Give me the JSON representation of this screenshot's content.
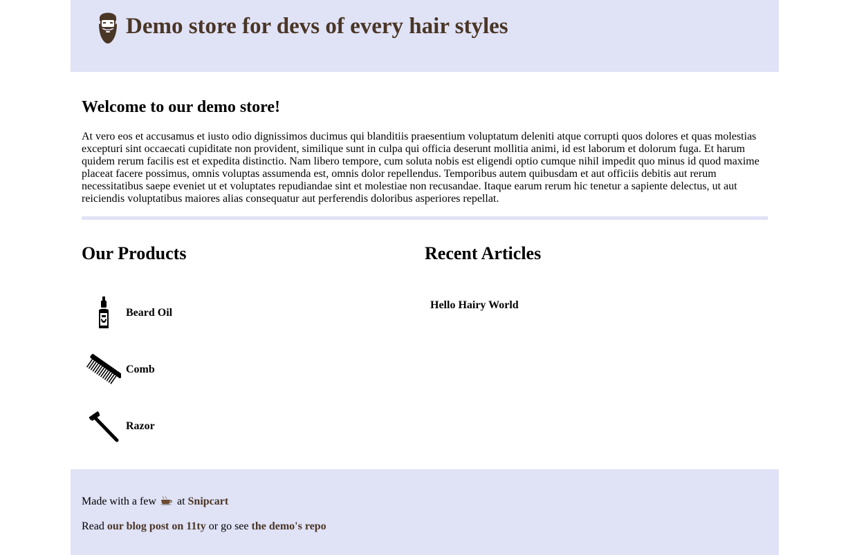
{
  "header": {
    "logo_icon": "bearded-man-icon",
    "title": "Demo store for devs of every hair styles",
    "brand_color": "#4a3626",
    "background": "#e0e2f6"
  },
  "main": {
    "welcome_title": "Welcome to our demo store!",
    "intro_text": "At vero eos et accusamus et iusto odio dignissimos ducimus qui blanditiis praesentium voluptatum deleniti atque corrupti quos dolores et quas molestias excepturi sint occaecati cupiditate non provident, similique sunt in culpa qui officia deserunt mollitia animi, id est laborum et dolorum fuga. Et harum quidem rerum facilis est et expedita distinctio. Nam libero tempore, cum soluta nobis est eligendi optio cumque nihil impedit quo minus id quod maxime placeat facere possimus, omnis voluptas assumenda est, omnis dolor repellendus. Temporibus autem quibusdam et aut officiis debitis aut rerum necessitatibus saepe eveniet ut et voluptates repudiandae sint et molestiae non recusandae. Itaque earum rerum hic tenetur a sapiente delectus, ut aut reiciendis voluptatibus maiores alias consequatur aut perferendis doloribus asperiores repellat.",
    "products_title": "Our Products",
    "products": [
      {
        "name": "Beard Oil",
        "icon": "beard-oil-bottle-icon"
      },
      {
        "name": "Comb",
        "icon": "comb-icon"
      },
      {
        "name": "Razor",
        "icon": "razor-icon"
      }
    ],
    "articles_title": "Recent Articles",
    "articles": [
      {
        "title": "Hello Hairy World"
      }
    ]
  },
  "footer": {
    "line1_prefix": "Made with a few",
    "line1_icon": "coffee-icon",
    "line1_middle": "at",
    "line1_link": "Snipcart",
    "line2_prefix": "Read",
    "line2_link1": "our blog post on 11ty",
    "line2_middle": "or go see",
    "line2_link2": "the demo's repo"
  }
}
